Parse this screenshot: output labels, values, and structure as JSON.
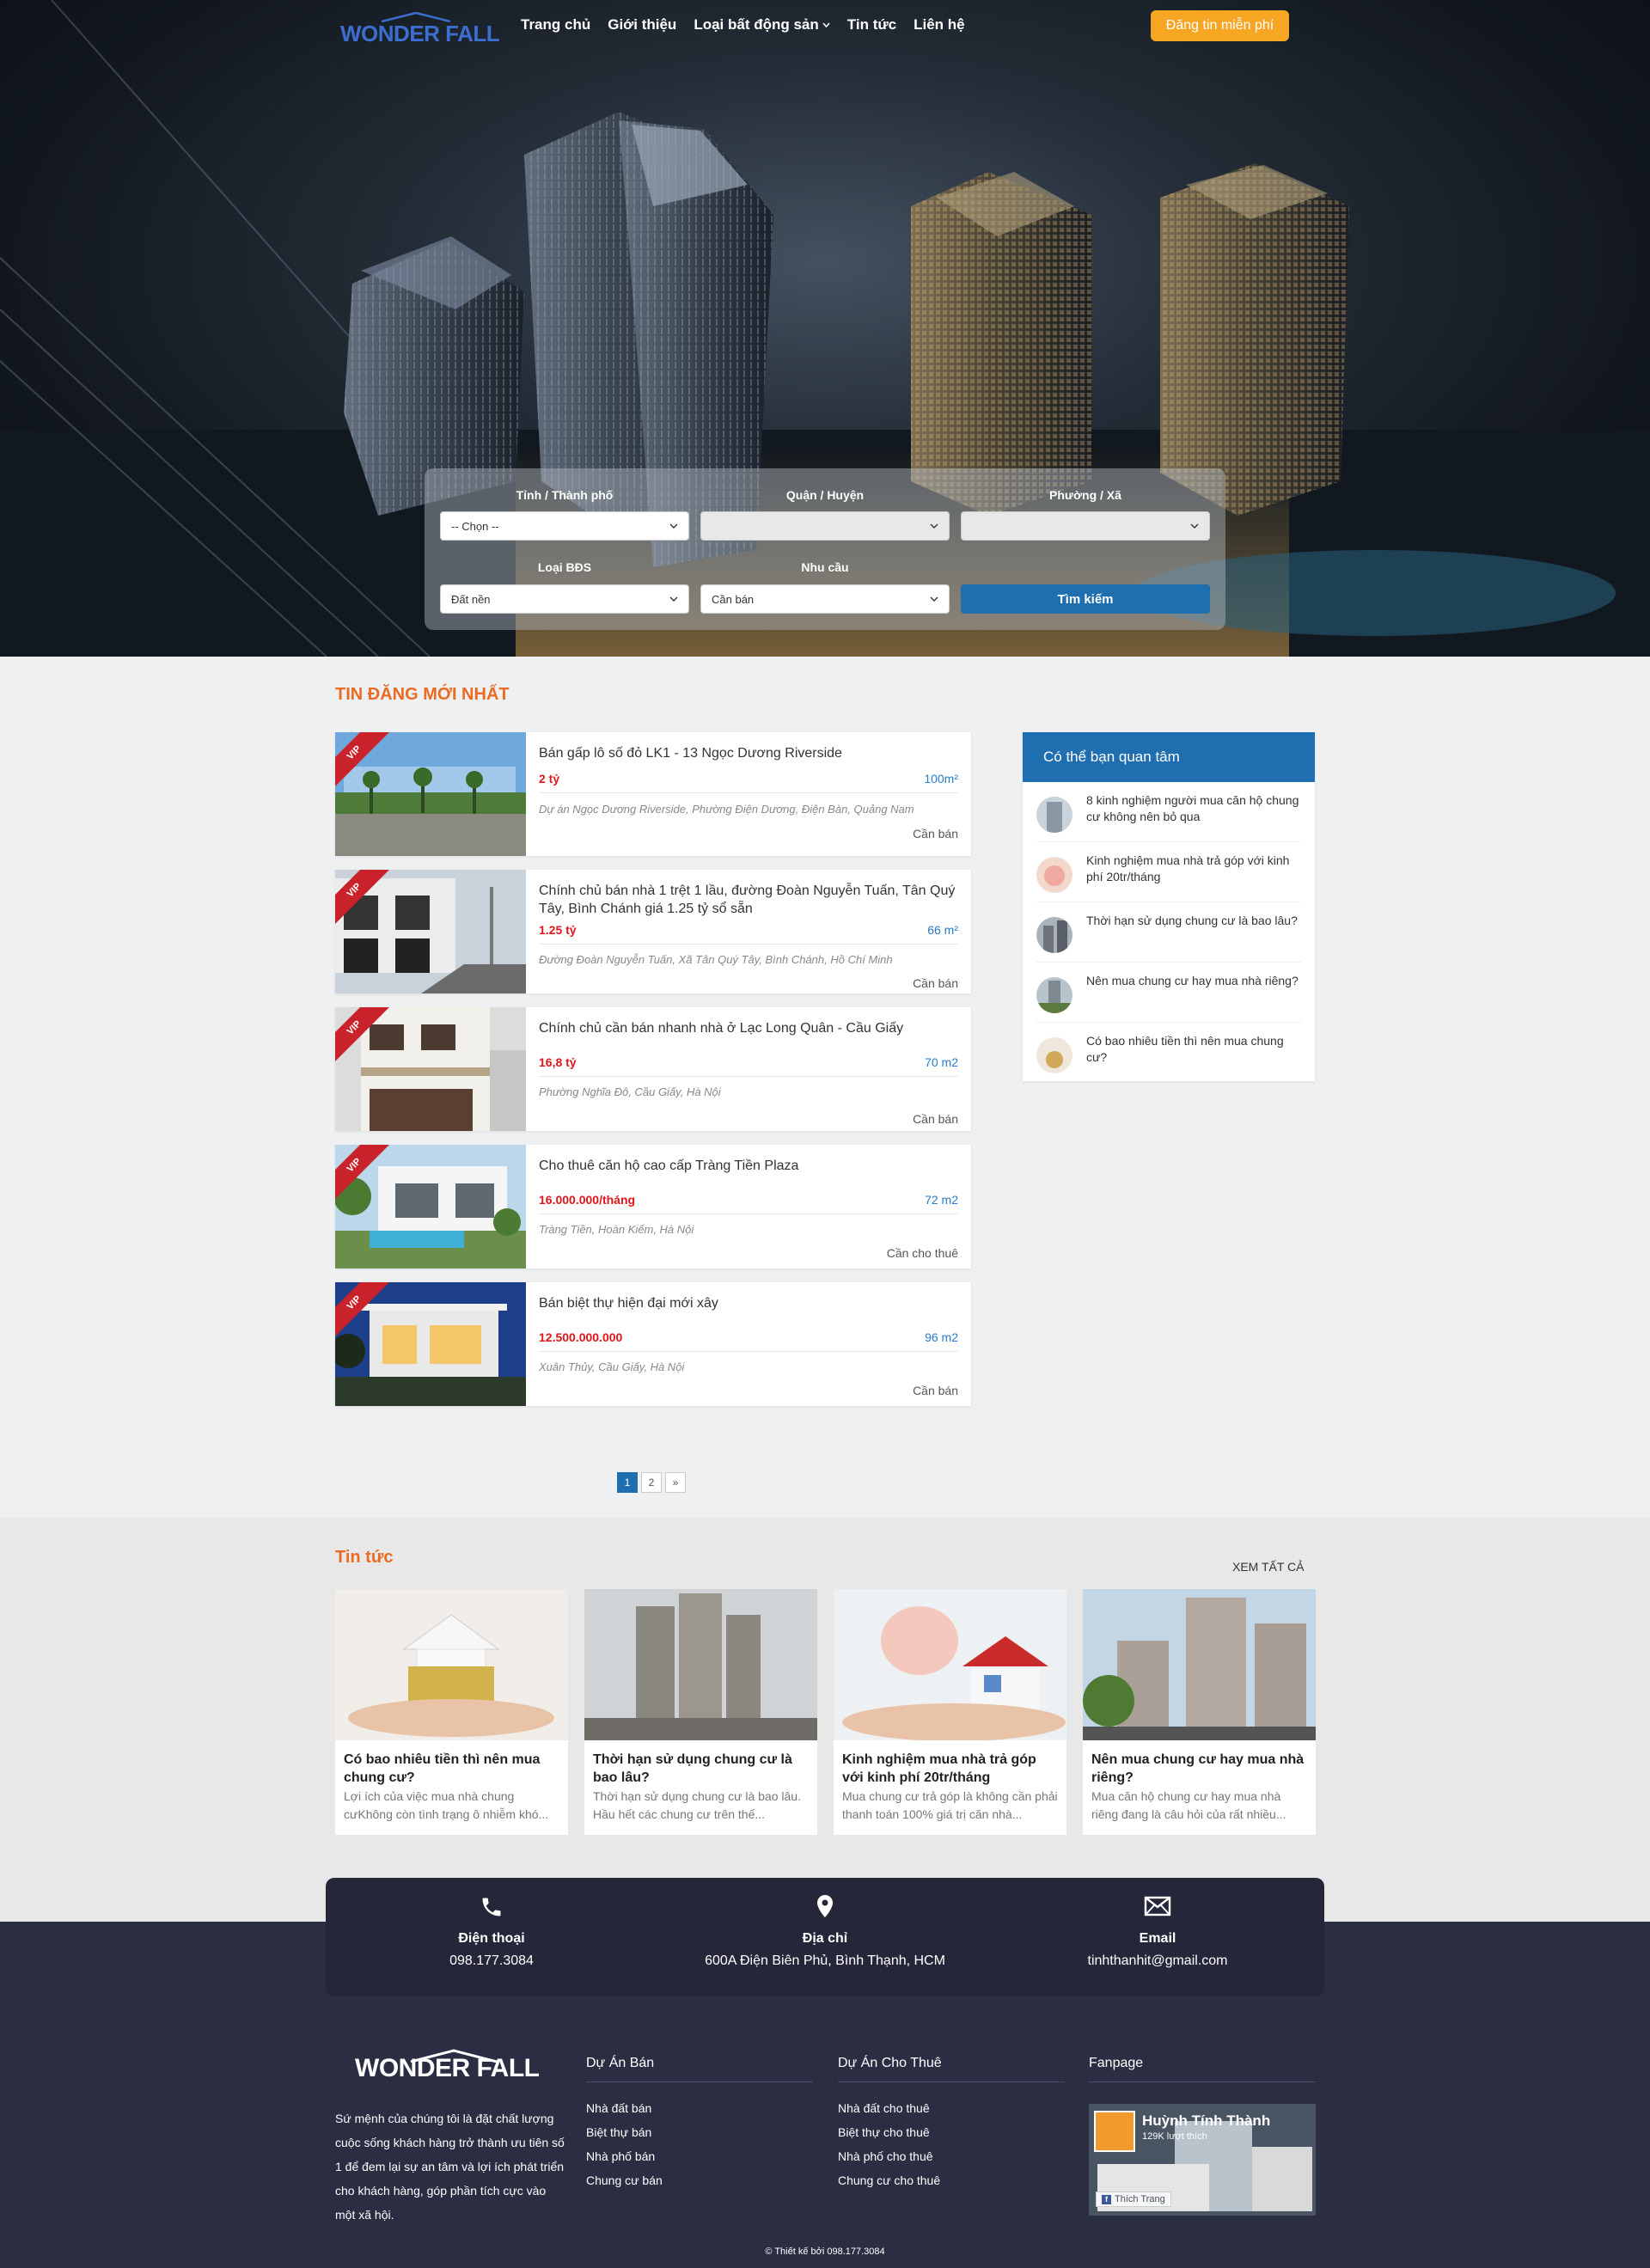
{
  "brand": {
    "logo": "WONDER FALL"
  },
  "nav": {
    "items": [
      "Trang chủ",
      "Giới thiệu",
      "Loại bất động sản",
      "Tin tức",
      "Liên hệ"
    ],
    "post_label": "Đăng tin miễn phí"
  },
  "search": {
    "province_label": "Tỉnh / Thành phố",
    "province_value": "-- Chọn --",
    "district_label": "Quận / Huyện",
    "district_value": "",
    "ward_label": "Phường / Xã",
    "ward_value": "",
    "type_label": "Loại BĐS",
    "type_value": "Đất nền",
    "need_label": "Nhu cầu",
    "need_value": "Cần bán",
    "button": "Tìm kiếm"
  },
  "latest": {
    "title": "TIN ĐĂNG MỚI NHẤT",
    "vip": "VIP",
    "items": [
      {
        "title": "Bán gấp lô số đỏ LK1 - 13 Ngọc Dương Riverside",
        "price": "2 tỷ",
        "area": "100m²",
        "address": "Dự án Ngọc Dương Riverside, Phường Điện Dương, Điện Bàn, Quảng Nam",
        "type": "Cần bán"
      },
      {
        "title": "Chính chủ bán nhà 1 trệt 1 lầu, đường Đoàn Nguyễn Tuấn, Tân Quý Tây, Bình Chánh giá 1.25 tỷ sổ sẵn",
        "price": "1.25 tỷ",
        "area": "66 m²",
        "address": "Đường Đoàn Nguyễn Tuấn, Xã Tân Quý Tây, Bình Chánh, Hồ Chí Minh",
        "type": "Cần bán"
      },
      {
        "title": "Chính chủ cần bán nhanh nhà ở Lạc Long Quân - Cầu Giấy",
        "price": "16,8 tỷ",
        "area": "70 m2",
        "address": "Phường Nghĩa Đô, Cầu Giấy, Hà Nội",
        "type": "Cần bán"
      },
      {
        "title": "Cho thuê căn hộ cao cấp Tràng Tiền Plaza",
        "price": "16.000.000/tháng",
        "area": "72 m2",
        "address": "Tràng Tiền, Hoàn Kiếm, Hà Nội",
        "type": "Cần cho thuê"
      },
      {
        "title": "Bán biệt thự hiện đại mới xây",
        "price": "12.500.000.000",
        "area": "96 m2",
        "address": "Xuân Thủy, Cầu Giấy, Hà Nội",
        "type": "Cần bán"
      }
    ]
  },
  "sidebar": {
    "title": "Có thể bạn quan tâm",
    "items": [
      "8 kinh nghiệm người mua căn hộ chung cư không nên bỏ qua",
      "Kinh nghiệm mua nhà trả góp với kinh phí 20tr/tháng",
      "Thời hạn sử dụng chung cư là bao lâu?",
      "Nên mua chung cư hay mua nhà riêng?",
      "Có bao nhiêu tiền thì nên mua chung cư?"
    ]
  },
  "pagination": {
    "pages": [
      "1",
      "2",
      "»"
    ]
  },
  "news": {
    "title": "Tin tức",
    "see_all": "XEM TẤT CẢ",
    "items": [
      {
        "title": "Có bao nhiêu tiền thì nên mua chung cư?",
        "desc": "Lợi ích của việc mua nhà chung cưKhông còn tình trạng ô nhiễm khó..."
      },
      {
        "title": "Thời hạn sử dụng chung cư là bao lâu?",
        "desc": "Thời hạn sử dụng chung cư là bao lâu. Hầu hết các chung cư trên thế..."
      },
      {
        "title": "Kinh nghiệm mua nhà trả góp với kinh phí 20tr/tháng",
        "desc": "Mua chung cư trả góp là không cần phải thanh toán 100% giá trị căn nhà..."
      },
      {
        "title": "Nên mua chung cư hay mua nhà riêng?",
        "desc": "Mua căn hộ chung cư hay mua nhà riêng đang là câu hỏi của rất nhiều..."
      }
    ]
  },
  "contact": {
    "phone_label": "Điện thoại",
    "phone": "098.177.3084",
    "address_label": "Địa chỉ",
    "address": "600A Điện Biên Phủ, Bình Thạnh, HCM",
    "email_label": "Email",
    "email": "tinhthanhit@gmail.com"
  },
  "footer": {
    "about": "Sứ mệnh của chúng tôi là đặt chất lượng cuộc sống khách hàng trở thành ưu tiên số 1 để đem lại sự an tâm và lợi ích phát triển cho khách hàng, góp phần tích cực vào một xã hội.",
    "col1_title": "Dự Án Bán",
    "col1": [
      "Nhà đất bán",
      "Biệt thự bán",
      "Nhà phố bán",
      "Chung cư bán"
    ],
    "col2_title": "Dự Án Cho Thuê",
    "col2": [
      "Nhà đất cho thuê",
      "Biệt thự cho thuê",
      "Nhà phố cho thuê",
      "Chung cư cho thuê"
    ],
    "fanpage_title": "Fanpage",
    "fanpage_name": "Huỳnh Tính Thành",
    "fanpage_likes": "129K lượt thích",
    "fanpage_like_btn": "Thích Trang",
    "copyright": "© Thiết kế bởi 098.177.3084"
  }
}
